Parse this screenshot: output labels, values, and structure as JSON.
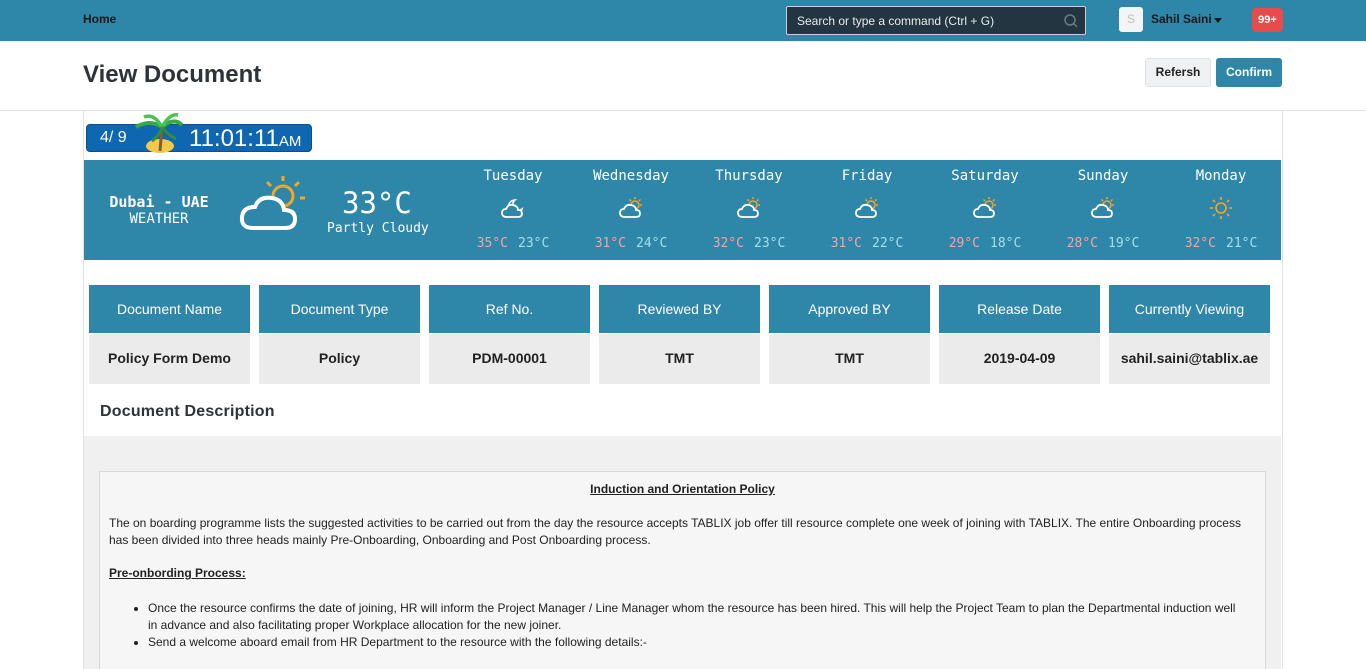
{
  "nav": {
    "home": "Home",
    "search_placeholder": "Search or type a command (Ctrl + G)",
    "avatar_initial": "S",
    "user_name": "Sahil Saini",
    "notifications": "99+"
  },
  "page": {
    "title": "View Document",
    "refresh_label": "Refersh",
    "confirm_label": "Confirm"
  },
  "clock": {
    "date": "4/ 9",
    "time": "11:01:11",
    "ampm": "AM"
  },
  "weather": {
    "city": "Dubai - UAE",
    "label": "WEATHER",
    "temp": "33°C",
    "condition": "Partly Cloudy",
    "current_icon": "partly-cloudy-icon",
    "days": [
      {
        "name": "Tuesday",
        "hi": "35°C",
        "lo": "23°C",
        "icon": "cloudy-moon-icon"
      },
      {
        "name": "Wednesday",
        "hi": "31°C",
        "lo": "24°C",
        "icon": "partly-cloudy-icon"
      },
      {
        "name": "Thursday",
        "hi": "32°C",
        "lo": "23°C",
        "icon": "partly-cloudy-icon"
      },
      {
        "name": "Friday",
        "hi": "31°C",
        "lo": "22°C",
        "icon": "partly-cloudy-icon"
      },
      {
        "name": "Saturday",
        "hi": "29°C",
        "lo": "18°C",
        "icon": "partly-cloudy-icon"
      },
      {
        "name": "Sunday",
        "hi": "28°C",
        "lo": "19°C",
        "icon": "partly-cloudy-icon"
      },
      {
        "name": "Monday",
        "hi": "32°C",
        "lo": "21°C",
        "icon": "sun-icon"
      }
    ],
    "colors": {
      "bg": "#2e86a9",
      "hi": "#f4a3a3",
      "lo": "#9fe0ee",
      "sun": "#f5a623"
    }
  },
  "info": [
    {
      "label": "Document Name",
      "value": "Policy Form Demo"
    },
    {
      "label": "Document Type",
      "value": "Policy"
    },
    {
      "label": "Ref No.",
      "value": "PDM-00001"
    },
    {
      "label": "Reviewed BY",
      "value": "TMT"
    },
    {
      "label": "Approved BY",
      "value": "TMT"
    },
    {
      "label": "Release Date",
      "value": "2019-04-09"
    },
    {
      "label": "Currently Viewing",
      "value": "sahil.saini@tablix.ae"
    }
  ],
  "description": {
    "title": "Document Description",
    "heading": "Induction and Orientation Policy",
    "paragraph": "The on boarding programme lists the suggested activities to be carried out from the day the resource accepts TABLIX job offer till resource complete one week of joining with TABLIX. The entire Onboarding process has been divided into three heads mainly Pre-Onboarding, Onboarding and Post Onboarding process.",
    "subheading": "Pre-onbording Process:",
    "bullets": [
      "Once the resource confirms the date of joining, HR will inform the Project Manager / Line Manager whom the resource has been hired. This will help the Project Team to plan the Departmental induction well in advance and also facilitating proper Workplace allocation for the new joiner.",
      "Send a welcome aboard email from HR Department to the resource with the following details:-"
    ]
  }
}
